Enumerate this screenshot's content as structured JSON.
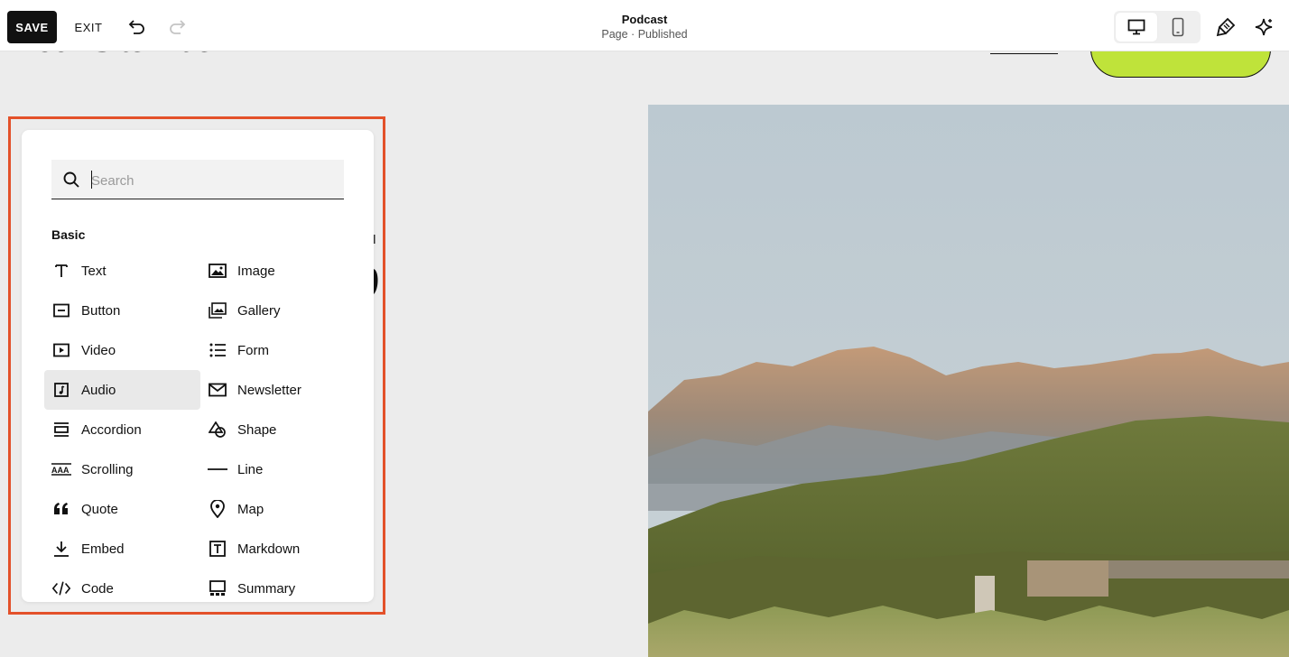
{
  "toolbar": {
    "save_label": "SAVE",
    "exit_label": "EXIT",
    "page_title": "Podcast",
    "page_status": "Page · Published",
    "device_view": "desktop"
  },
  "site": {
    "title": "Your Site Title",
    "accent_color": "#bfe33a"
  },
  "panel": {
    "search_placeholder": "Search",
    "section": "Basic",
    "highlight_color": "#e3512a",
    "left_column": [
      {
        "label": "Text",
        "icon": "text-icon"
      },
      {
        "label": "Button",
        "icon": "button-icon"
      },
      {
        "label": "Video",
        "icon": "video-icon"
      },
      {
        "label": "Audio",
        "icon": "audio-icon",
        "selected": true
      },
      {
        "label": "Accordion",
        "icon": "accordion-icon"
      },
      {
        "label": "Scrolling",
        "icon": "scrolling-icon"
      },
      {
        "label": "Quote",
        "icon": "quote-icon"
      },
      {
        "label": "Embed",
        "icon": "embed-icon"
      },
      {
        "label": "Code",
        "icon": "code-icon"
      }
    ],
    "right_column": [
      {
        "label": "Image",
        "icon": "image-icon"
      },
      {
        "label": "Gallery",
        "icon": "gallery-icon"
      },
      {
        "label": "Form",
        "icon": "form-icon"
      },
      {
        "label": "Newsletter",
        "icon": "newsletter-icon"
      },
      {
        "label": "Shape",
        "icon": "shape-icon"
      },
      {
        "label": "Line",
        "icon": "line-icon"
      },
      {
        "label": "Map",
        "icon": "map-icon"
      },
      {
        "label": "Markdown",
        "icon": "markdown-icon"
      },
      {
        "label": "Summary",
        "icon": "summary-icon"
      }
    ]
  }
}
